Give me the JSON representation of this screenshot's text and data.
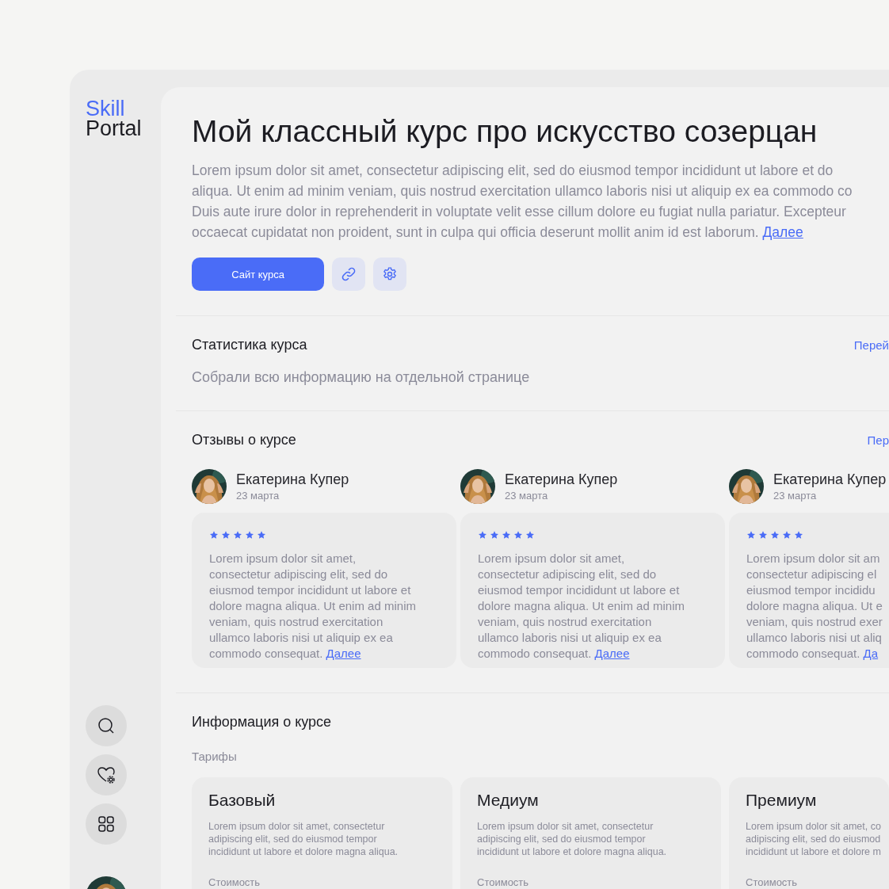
{
  "sidebar": {
    "logo": {
      "accent": "Skill",
      "rest": "Portal"
    }
  },
  "course": {
    "title": "Мой классный курс про искусство созерцан",
    "description": "Lorem ipsum dolor sit amet, consectetur adipiscing elit, sed do eiusmod tempor incididunt ut labore et do\naliqua. Ut enim ad minim veniam, quis nostrud exercitation ullamco laboris nisi ut aliquip ex ea commodo co\nDuis aute irure dolor in reprehenderit in voluptate velit esse cillum dolore eu fugiat nulla pariatur. Excepteur\noccaecat cupidatat non proident, sunt in culpa qui officia deserunt mollit anim id est laborum.",
    "more": "Далее",
    "primary_button": "Сайт курса"
  },
  "stats": {
    "title": "Статистика курса",
    "link": "Перей",
    "text": "Собрали всю информацию на отдельной странице"
  },
  "reviews": {
    "title": "Отзывы о курсе",
    "link": "Пер",
    "items": [
      {
        "name": "Екатерина Купер",
        "date": "23 марта",
        "stars": 5,
        "text": "Lorem ipsum dolor sit amet,\nconsectetur adipiscing elit, sed do\neiusmod tempor incididunt ut labore et\ndolore magna aliqua. Ut enim ad minim\nveniam, quis nostrud exercitation\nullamco laboris nisi ut aliquip ex ea\ncommodo consequat.",
        "more": "Далее"
      },
      {
        "name": "Екатерина Купер",
        "date": "23 марта",
        "stars": 5,
        "text": "Lorem ipsum dolor sit amet,\nconsectetur adipiscing elit, sed do\neiusmod tempor incididunt ut labore et\ndolore magna aliqua. Ut enim ad minim\nveniam, quis nostrud exercitation\nullamco laboris nisi ut aliquip ex ea\ncommodo consequat.",
        "more": "Далее"
      },
      {
        "name": "Екатерина Купер",
        "date": "23 марта",
        "stars": 5,
        "text": "Lorem ipsum dolor sit am\nconsectetur adipiscing el\neiusmod tempor incididu\ndolore magna aliqua. Ut e\nveniam, quis nostrud exer\nullamco laboris nisi ut aliq\ncommodo consequat.",
        "more": "Да"
      }
    ]
  },
  "info": {
    "title": "Информация о курсе",
    "subtitle": "Тарифы",
    "tariffs": [
      {
        "name": "Базовый",
        "text": "Lorem ipsum dolor sit amet, consectetur\nadipiscing elit, sed do eiusmod tempor\nincididunt ut labore et dolore magna aliqua.",
        "price_label": "Стоимость"
      },
      {
        "name": "Медиум",
        "text": "Lorem ipsum dolor sit amet, consectetur\nadipiscing elit, sed do eiusmod tempor\nincididunt ut labore et dolore magna aliqua.",
        "price_label": "Стоимость"
      },
      {
        "name": "Премиум",
        "text": "Lorem ipsum dolor sit amet, co\nadipiscing elit, sed do eiusmod\nincididunt ut labore et dolore m",
        "price_label": "Стоимость"
      }
    ]
  }
}
